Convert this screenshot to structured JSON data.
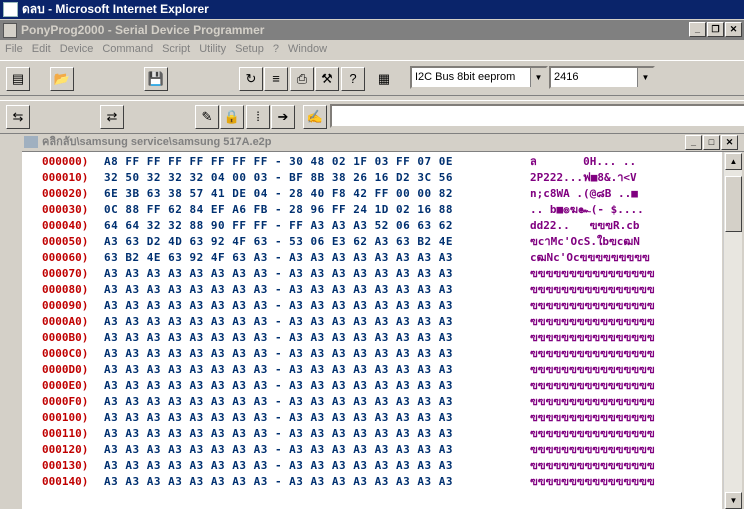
{
  "ie_window": {
    "title": "ดลบ - Microsoft Internet Explorer"
  },
  "app_window": {
    "title": "PonyProg2000 - Serial Device Programmer"
  },
  "menu": [
    "File",
    "Edit",
    "Device",
    "Command",
    "Script",
    "Utility",
    "Setup",
    "?",
    "Window"
  ],
  "device": {
    "bus": "I2C Bus 8bit eeprom",
    "model": "2416"
  },
  "document": {
    "title": "คลิกลับ\\samsung service\\samsung 517A.e2p"
  },
  "hex_rows": [
    {
      "addr": "000000)",
      "hex": "A8 FF FF FF FF FF FF FF - 30 48 02 1F 03 FF 07 0E",
      "ascii": "ล       0H... .."
    },
    {
      "addr": "000010)",
      "hex": "32 50 32 32 32 04 00 03 - BF 8B 38 26 16 D2 3C 56",
      "ascii": "2P222...ฟ■8&.า<V"
    },
    {
      "addr": "000020)",
      "hex": "6E 3B 63 38 57 41 DE 04 - 28 40 F8 42 FF 00 00 82",
      "ascii": "n;c8WA .(@๘B ..■"
    },
    {
      "addr": "000030)",
      "hex": "0C 88 FF 62 84 EF A6 FB - 28 96 FF 24 1D 02 16 88",
      "ascii": ".. b■๏ฆ๛(- $...."
    },
    {
      "addr": "000040)",
      "hex": "64 64 32 32 88 90 FF FF - FF A3 A3 A3 52 06 63 62",
      "ascii": "dd22..   ฃฃฃR.cb"
    },
    {
      "addr": "000050)",
      "hex": "A3 63 D2 4D 63 92 4F 63 - 53 06 E3 62 A3 63 B2 4E",
      "ascii": "ฃcาMc'OcS.ใbฃcฒN"
    },
    {
      "addr": "000060)",
      "hex": "63 B2 4E 63 92 4F 63 A3 - A3 A3 A3 A3 A3 A3 A3 A3",
      "ascii": "cฒNc'Ocฃฃฃฃฃฃฃฃฃ"
    },
    {
      "addr": "000070)",
      "hex": "A3 A3 A3 A3 A3 A3 A3 A3 - A3 A3 A3 A3 A3 A3 A3 A3",
      "ascii": "ฃฃฃฃฃฃฃฃฃฃฃฃฃฃฃฃ"
    },
    {
      "addr": "000080)",
      "hex": "A3 A3 A3 A3 A3 A3 A3 A3 - A3 A3 A3 A3 A3 A3 A3 A3",
      "ascii": "ฃฃฃฃฃฃฃฃฃฃฃฃฃฃฃฃ"
    },
    {
      "addr": "000090)",
      "hex": "A3 A3 A3 A3 A3 A3 A3 A3 - A3 A3 A3 A3 A3 A3 A3 A3",
      "ascii": "ฃฃฃฃฃฃฃฃฃฃฃฃฃฃฃฃ"
    },
    {
      "addr": "0000A0)",
      "hex": "A3 A3 A3 A3 A3 A3 A3 A3 - A3 A3 A3 A3 A3 A3 A3 A3",
      "ascii": "ฃฃฃฃฃฃฃฃฃฃฃฃฃฃฃฃ"
    },
    {
      "addr": "0000B0)",
      "hex": "A3 A3 A3 A3 A3 A3 A3 A3 - A3 A3 A3 A3 A3 A3 A3 A3",
      "ascii": "ฃฃฃฃฃฃฃฃฃฃฃฃฃฃฃฃ"
    },
    {
      "addr": "0000C0)",
      "hex": "A3 A3 A3 A3 A3 A3 A3 A3 - A3 A3 A3 A3 A3 A3 A3 A3",
      "ascii": "ฃฃฃฃฃฃฃฃฃฃฃฃฃฃฃฃ"
    },
    {
      "addr": "0000D0)",
      "hex": "A3 A3 A3 A3 A3 A3 A3 A3 - A3 A3 A3 A3 A3 A3 A3 A3",
      "ascii": "ฃฃฃฃฃฃฃฃฃฃฃฃฃฃฃฃ"
    },
    {
      "addr": "0000E0)",
      "hex": "A3 A3 A3 A3 A3 A3 A3 A3 - A3 A3 A3 A3 A3 A3 A3 A3",
      "ascii": "ฃฃฃฃฃฃฃฃฃฃฃฃฃฃฃฃ"
    },
    {
      "addr": "0000F0)",
      "hex": "A3 A3 A3 A3 A3 A3 A3 A3 - A3 A3 A3 A3 A3 A3 A3 A3",
      "ascii": "ฃฃฃฃฃฃฃฃฃฃฃฃฃฃฃฃ"
    },
    {
      "addr": "000100)",
      "hex": "A3 A3 A3 A3 A3 A3 A3 A3 - A3 A3 A3 A3 A3 A3 A3 A3",
      "ascii": "ฃฃฃฃฃฃฃฃฃฃฃฃฃฃฃฃ"
    },
    {
      "addr": "000110)",
      "hex": "A3 A3 A3 A3 A3 A3 A3 A3 - A3 A3 A3 A3 A3 A3 A3 A3",
      "ascii": "ฃฃฃฃฃฃฃฃฃฃฃฃฃฃฃฃ"
    },
    {
      "addr": "000120)",
      "hex": "A3 A3 A3 A3 A3 A3 A3 A3 - A3 A3 A3 A3 A3 A3 A3 A3",
      "ascii": "ฃฃฃฃฃฃฃฃฃฃฃฃฃฃฃฃ"
    },
    {
      "addr": "000130)",
      "hex": "A3 A3 A3 A3 A3 A3 A3 A3 - A3 A3 A3 A3 A3 A3 A3 A3",
      "ascii": "ฃฃฃฃฃฃฃฃฃฃฃฃฃฃฃฃ"
    },
    {
      "addr": "000140)",
      "hex": "A3 A3 A3 A3 A3 A3 A3 A3 - A3 A3 A3 A3 A3 A3 A3 A3",
      "ascii": "ฃฃฃฃฃฃฃฃฃฃฃฃฃฃฃฃ"
    }
  ],
  "colors": {
    "address": "#c00000",
    "hex": "#003070",
    "ascii": "#800080",
    "active_title": "#0a246a",
    "inactive_title": "#808080"
  }
}
